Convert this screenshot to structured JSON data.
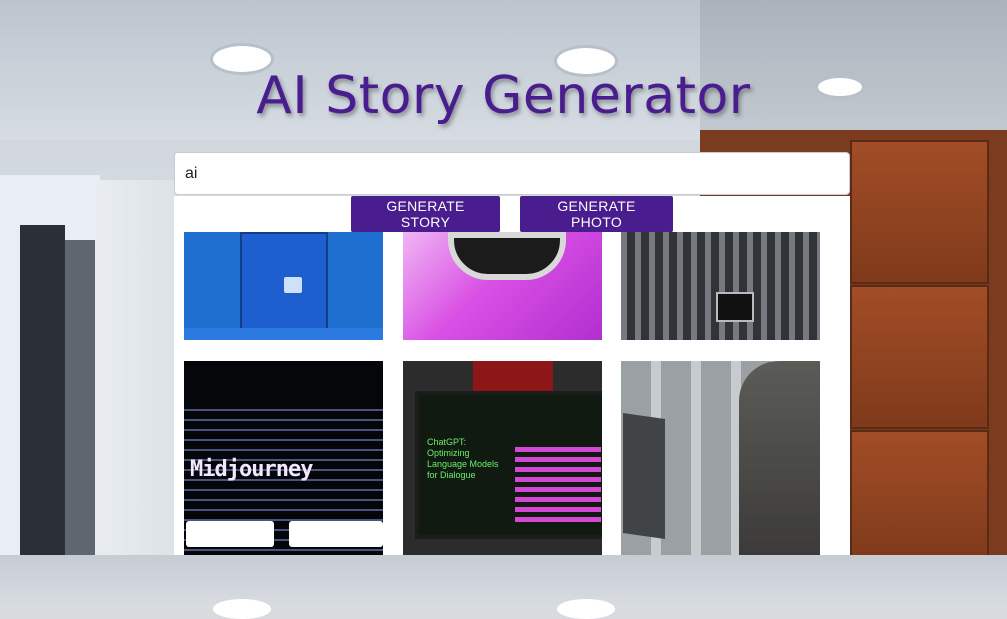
{
  "app": {
    "title": "AI Story Generator"
  },
  "search": {
    "value": "ai",
    "placeholder": ""
  },
  "actions": {
    "generate_story_label": "GENERATE STORY",
    "generate_photo_label": "GENERATE PHOTO"
  },
  "photos": {
    "tile4_text": "Midjourney",
    "tile5_text": "ChatGPT: Optimizing Language Models for Dialogue"
  },
  "colors": {
    "accent": "#4a1d8f",
    "title": "#4a1d8f"
  }
}
